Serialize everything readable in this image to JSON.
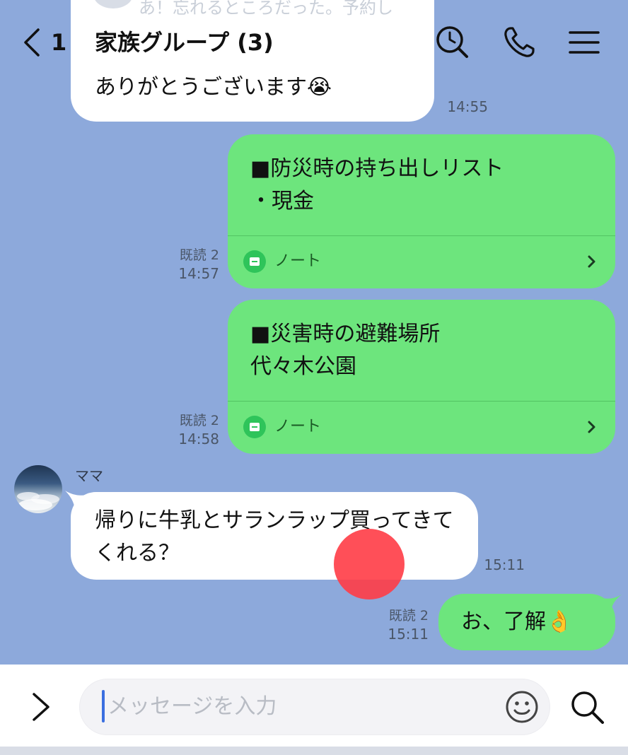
{
  "header": {
    "back_count": "1",
    "title": "家族グループ (3)",
    "icons": [
      "search-clock-icon",
      "phone-icon",
      "menu-icon"
    ]
  },
  "messages": {
    "prev_ghost_text": "あ！忘れるところだった。予約し",
    "prev_text": "ありがとうございます😭",
    "prev_time": "14:55",
    "note1": {
      "text": "■防災時の持ち出しリスト\n・現金",
      "label": "ノート",
      "read": "既読 2",
      "time": "14:57"
    },
    "note2": {
      "text": "■災害時の避難場所\n代々木公園",
      "label": "ノート",
      "read": "既読 2",
      "time": "14:58"
    },
    "mama": {
      "sender": "ママ",
      "text": "帰りに牛乳とサランラップ買ってきてくれる？",
      "time": "15:11"
    },
    "reply": {
      "text": "お、了解👌",
      "read": "既読 2",
      "time": "15:11"
    }
  },
  "input": {
    "placeholder": "メッセージを入力"
  },
  "colors": {
    "background": "#8DA9DB",
    "green_bubble": "#6DE57D",
    "white_bubble": "#FFFFFF",
    "note_icon": "#2FC45A",
    "caret": "#3B6FE0",
    "touch_indicator": "#FF3C46"
  }
}
